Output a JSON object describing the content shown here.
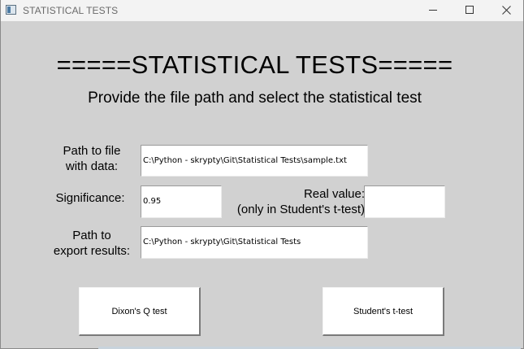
{
  "window": {
    "title": "STATISTICAL TESTS"
  },
  "main": {
    "heading": "=====STATISTICAL TESTS=====",
    "subheading": "Provide the file path and select the statistical test"
  },
  "form": {
    "file_path_label": "Path to file\nwith data:",
    "file_path_value": "C:\\Python - skrypty\\Git\\Statistical Tests\\sample.txt",
    "significance_label": "Significance:",
    "significance_value": "0.95",
    "real_value_label": "Real value:\n(only in Student's t-test)",
    "real_value_value": "",
    "export_path_label": "Path to\nexport results:",
    "export_path_value": "C:\\Python - skrypty\\Git\\Statistical Tests"
  },
  "buttons": {
    "dixon_label": "Dixon's Q test",
    "student_label": "Student's t-test"
  }
}
